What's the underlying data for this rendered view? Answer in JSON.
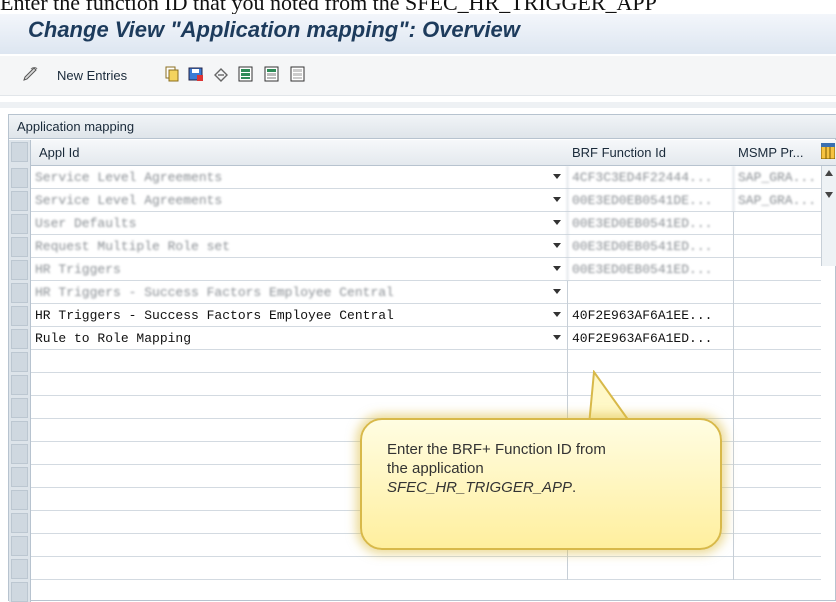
{
  "caption": "Enter the function ID that you noted from the SFEC_HR_TRIGGER_APP",
  "window": {
    "title": "Change View \"Application mapping\": Overview"
  },
  "toolbar": {
    "new_entries_label": "New Entries",
    "icons": [
      "edit-icon",
      "copy-icon",
      "save-icon",
      "undo-icon",
      "select-all-icon",
      "select-block-icon",
      "deselect-all-icon"
    ]
  },
  "table": {
    "title": "Application mapping",
    "columns": [
      "Appl Id",
      "BRF Function Id",
      "MSMP Pr..."
    ],
    "rows": [
      {
        "appl_id": "Service Level Agreements",
        "brf_id": "4CF3C3ED4F22444...",
        "msmp": "SAP_GRA...",
        "blurred": true
      },
      {
        "appl_id": "Service Level Agreements",
        "brf_id": "00E3ED0EB0541DE...",
        "msmp": "SAP_GRA...",
        "blurred": true
      },
      {
        "appl_id": "User Defaults",
        "brf_id": "00E3ED0EB0541ED...",
        "msmp": "",
        "blurred": true
      },
      {
        "appl_id": "Request Multiple Role set",
        "brf_id": "00E3ED0EB0541ED...",
        "msmp": "",
        "blurred": true
      },
      {
        "appl_id": "HR Triggers",
        "brf_id": "00E3ED0EB0541ED...",
        "msmp": "",
        "blurred": true
      },
      {
        "appl_id": "HR Triggers - Success Factors Employee Central",
        "brf_id": "",
        "msmp": "",
        "blurred": true
      },
      {
        "appl_id": "HR Triggers - Success Factors Employee Central",
        "brf_id": "40F2E963AF6A1EE...",
        "msmp": "",
        "blurred": false
      },
      {
        "appl_id": "Rule to Role Mapping",
        "brf_id": "40F2E963AF6A1ED...",
        "msmp": "",
        "blurred": false
      }
    ]
  },
  "callout": {
    "line1": "Enter the BRF+ Function ID from",
    "line2": "the application",
    "app_name": "SFEC_HR_TRIGGER_APP",
    "end": "."
  }
}
